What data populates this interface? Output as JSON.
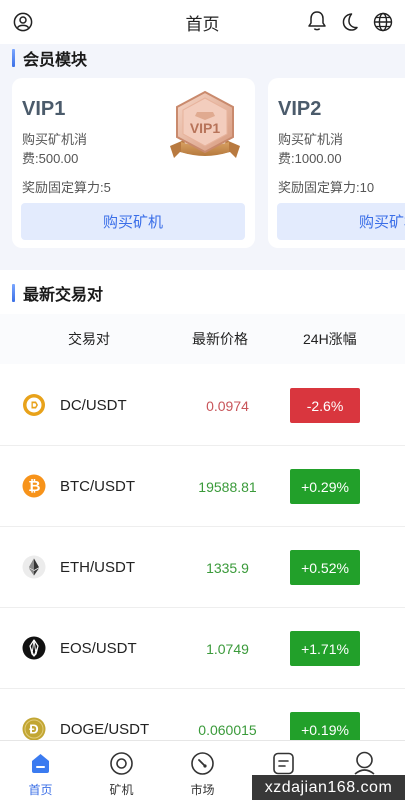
{
  "header": {
    "title": "首页"
  },
  "member_section": {
    "title": "会员模块",
    "cards": [
      {
        "name": "VIP1",
        "desc": "购买矿机消费:500.00",
        "reward": "奖励固定算力:5",
        "button": "购买矿机",
        "badge_text": "VIP1"
      },
      {
        "name": "VIP2",
        "desc": "购买矿机消费:1000.00",
        "reward": "奖励固定算力:10",
        "button": "购买矿机"
      }
    ]
  },
  "pairs_section": {
    "title": "最新交易对",
    "columns": [
      "交易对",
      "最新价格",
      "24H涨幅"
    ],
    "rows": [
      {
        "icon": "dc-coin-icon",
        "pair": "DC/USDT",
        "price": "0.0974",
        "change": "-2.6%",
        "trend": "down"
      },
      {
        "icon": "btc-coin-icon",
        "pair": "BTC/USDT",
        "price": "19588.81",
        "change": "+0.29%",
        "trend": "up"
      },
      {
        "icon": "eth-coin-icon",
        "pair": "ETH/USDT",
        "price": "1335.9",
        "change": "+0.52%",
        "trend": "up"
      },
      {
        "icon": "eos-coin-icon",
        "pair": "EOS/USDT",
        "price": "1.0749",
        "change": "+1.71%",
        "trend": "up"
      },
      {
        "icon": "doge-coin-icon",
        "pair": "DOGE/USDT",
        "price": "0.060015",
        "change": "+0.19%",
        "trend": "up"
      }
    ]
  },
  "bottom_nav": [
    {
      "label": "首页",
      "icon": "home-icon",
      "active": true
    },
    {
      "label": "矿机",
      "icon": "miner-icon",
      "active": false
    },
    {
      "label": "市场",
      "icon": "market-icon",
      "active": false
    },
    {
      "label": "",
      "icon": "orders-icon",
      "active": false
    },
    {
      "label": "",
      "icon": "profile-icon",
      "active": false
    }
  ],
  "watermark": "xzdajian168.com",
  "colors": {
    "accent": "#3b6fe6",
    "up": "#22a02a",
    "down": "#d9363e",
    "down_text": "#c8555a",
    "up_text": "#3a9a3a"
  }
}
